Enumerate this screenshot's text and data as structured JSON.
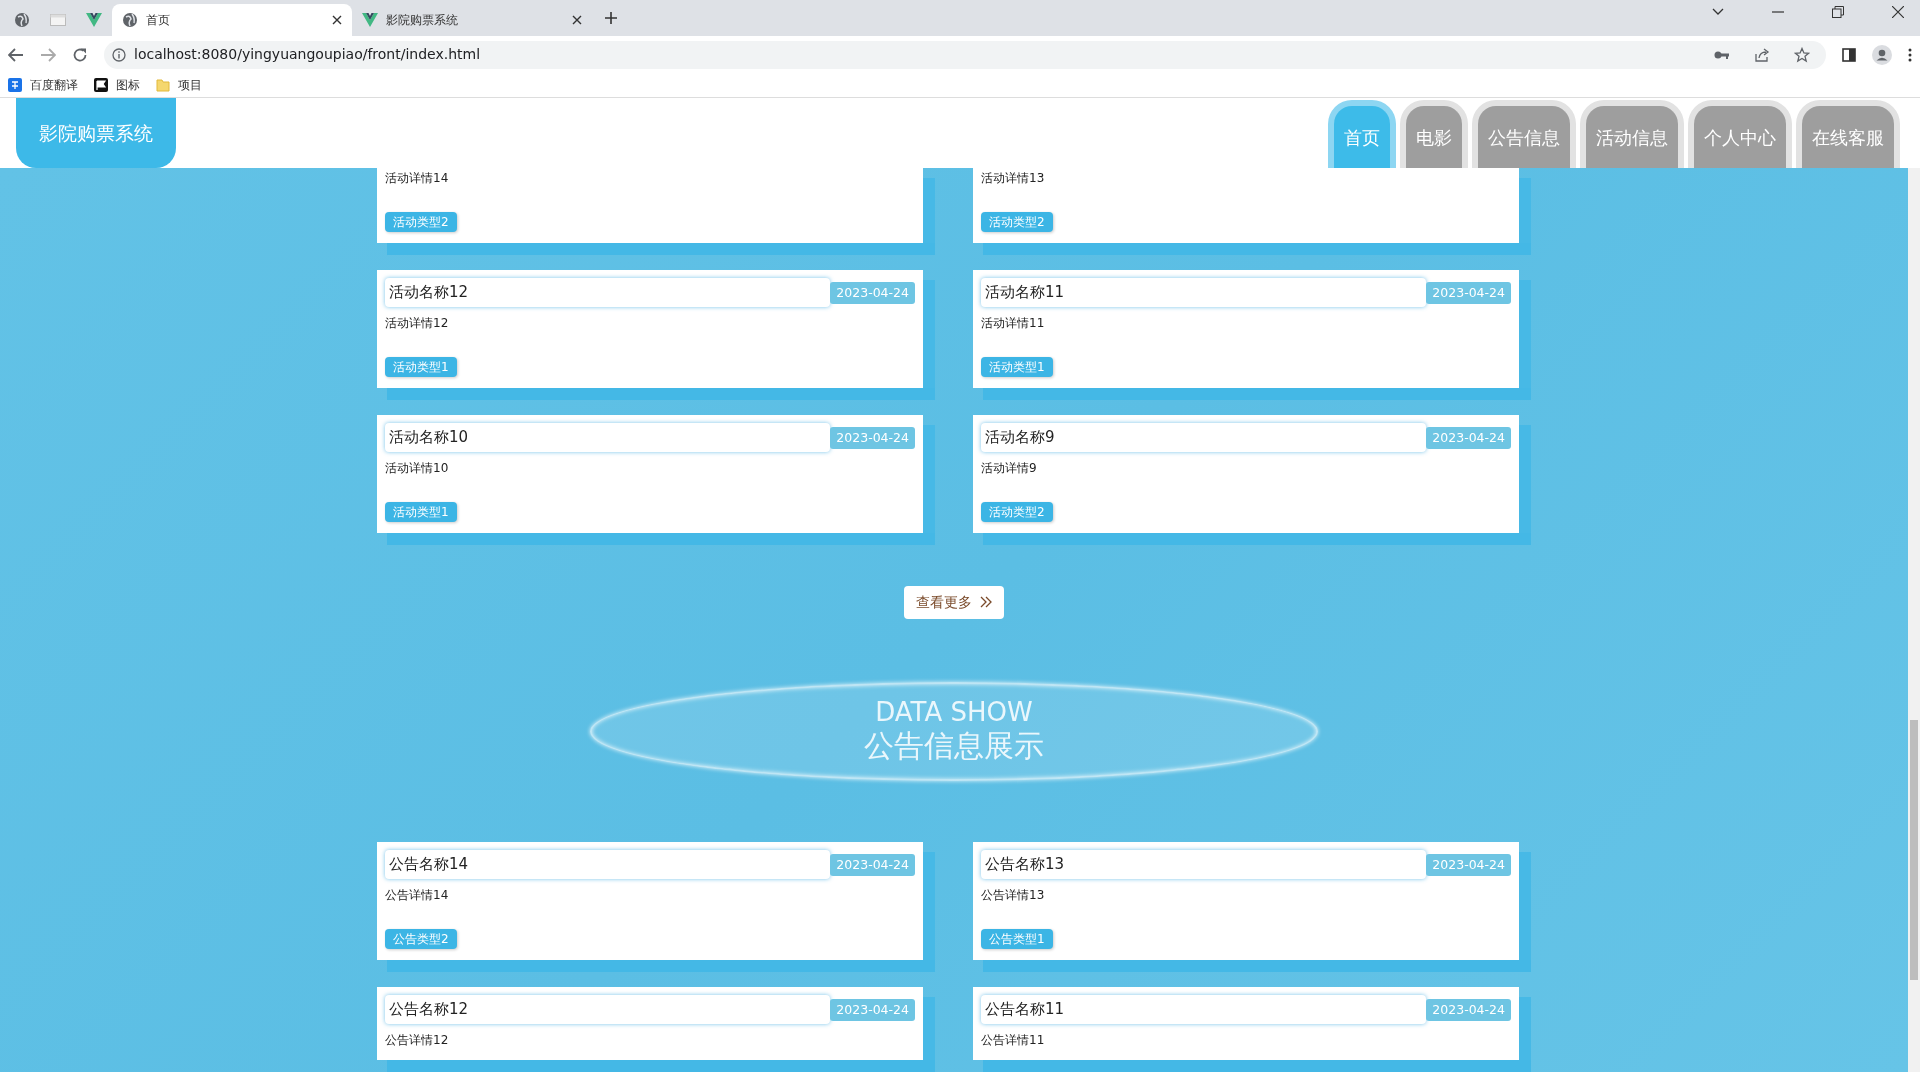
{
  "browser": {
    "tabs": [
      {
        "title": "首页",
        "selected": true
      },
      {
        "title": "影院购票系统",
        "selected": false
      }
    ],
    "url": "localhost:8080/yingyuangoupiao/front/index.html",
    "bookmarks": [
      "百度翻译",
      "图标",
      "项目"
    ]
  },
  "site": {
    "logo": "影院购票系统",
    "nav": [
      {
        "label": "首页",
        "selected": true
      },
      {
        "label": "电影",
        "selected": false
      },
      {
        "label": "公告信息",
        "selected": false
      },
      {
        "label": "活动信息",
        "selected": false
      },
      {
        "label": "个人中心",
        "selected": false
      },
      {
        "label": "在线客服",
        "selected": false
      }
    ]
  },
  "activities": [
    {
      "detail": "活动详情14",
      "type": "活动类型2"
    },
    {
      "detail": "活动详情13",
      "type": "活动类型2"
    },
    {
      "name": "活动名称12",
      "date": "2023-04-24",
      "detail": "活动详情12",
      "type": "活动类型1"
    },
    {
      "name": "活动名称11",
      "date": "2023-04-24",
      "detail": "活动详情11",
      "type": "活动类型1"
    },
    {
      "name": "活动名称10",
      "date": "2023-04-24",
      "detail": "活动详情10",
      "type": "活动类型1"
    },
    {
      "name": "活动名称9",
      "date": "2023-04-24",
      "detail": "活动详情9",
      "type": "活动类型2"
    }
  ],
  "more_button": "查看更多",
  "notice_section": {
    "subtitle": "DATA SHOW",
    "title": "公告信息展示"
  },
  "notices": [
    {
      "name": "公告名称14",
      "date": "2023-04-24",
      "detail": "公告详情14",
      "type": "公告类型2"
    },
    {
      "name": "公告名称13",
      "date": "2023-04-24",
      "detail": "公告详情13",
      "type": "公告类型1"
    },
    {
      "name": "公告名称12",
      "date": "2023-04-24",
      "detail": "公告详情12"
    },
    {
      "name": "公告名称11",
      "date": "2023-04-24",
      "detail": "公告详情11"
    }
  ]
}
